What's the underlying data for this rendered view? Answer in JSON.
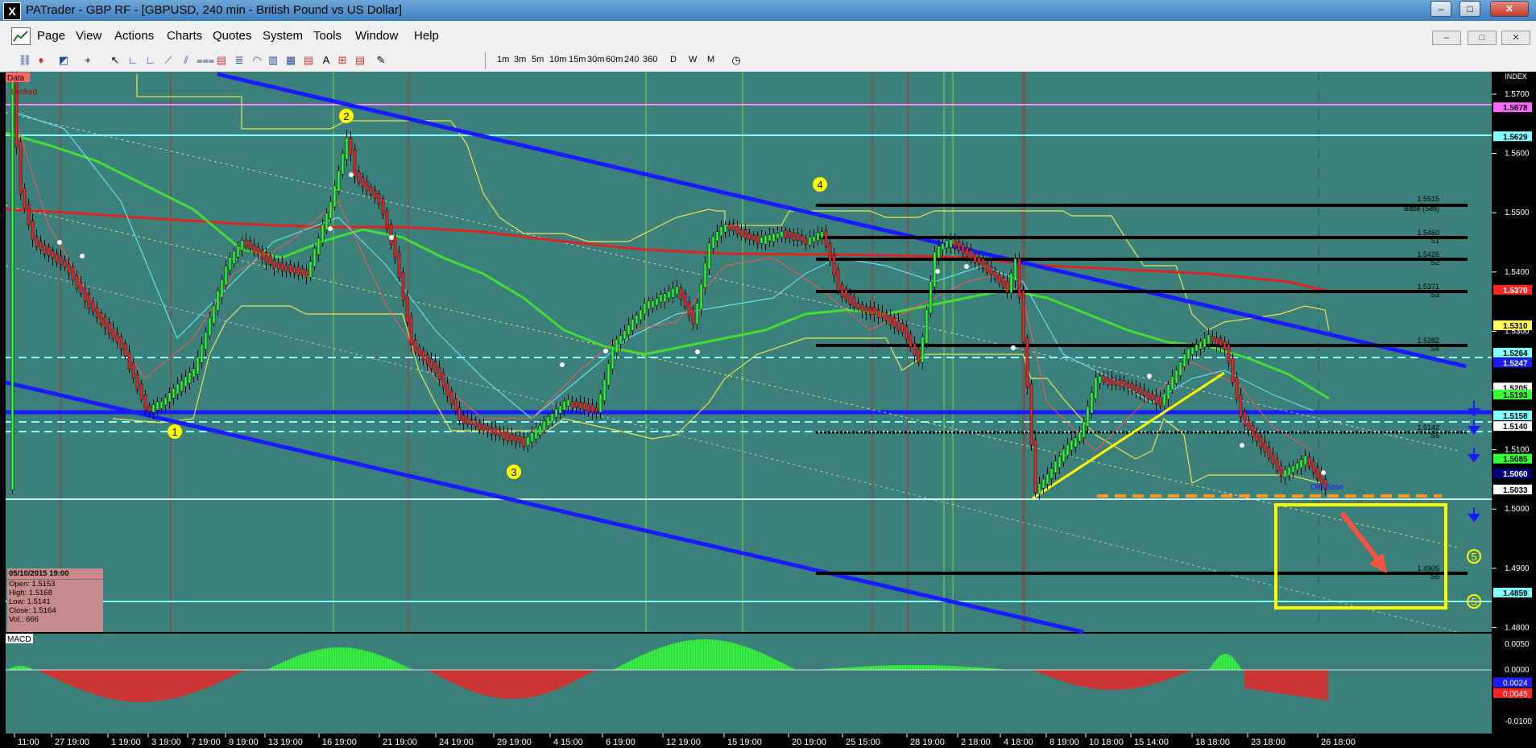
{
  "window": {
    "title": "PATrader - GBP RF - [GBPUSD, 240 min - British Pound vs US Dollar]",
    "app_icon": "X",
    "minimize": "–",
    "maximize": "□",
    "close": "✕"
  },
  "menu": [
    "Page",
    "View",
    "Actions",
    "Charts",
    "Quotes",
    "System",
    "Tools",
    "Window",
    "Help"
  ],
  "timeframes": [
    "1m",
    "3m",
    "5m",
    "10m",
    "15m",
    "30m",
    "60m",
    "240",
    "360",
    "D",
    "W",
    "M"
  ],
  "chart": {
    "top_label_data": "Data",
    "top_label_locked": "Locked",
    "index_label": "INDEX",
    "macd_label": "MACD",
    "price_ticks": [
      "1.5700",
      "1.5600",
      "1.5500",
      "1.5400",
      "1.5300",
      "1.5200",
      "1.5100",
      "1.5000",
      "1.4900",
      "1.4800"
    ],
    "price_flags": [
      {
        "text": "1.5678",
        "bg": "#ff66ff",
        "fg": "#000"
      },
      {
        "text": "1.5629",
        "bg": "#7fffff",
        "fg": "#000"
      },
      {
        "text": "1.5370",
        "bg": "#ff2222",
        "fg": "#fff"
      },
      {
        "text": "1.5310",
        "bg": "#ffff55",
        "fg": "#000"
      },
      {
        "text": "1.5264",
        "bg": "#7fffff",
        "fg": "#000"
      },
      {
        "text": "1.5247",
        "bg": "#1a1aff",
        "fg": "#fff"
      },
      {
        "text": "1.5205",
        "bg": "#ffffff",
        "fg": "#000"
      },
      {
        "text": "1.5193",
        "bg": "#33ff33",
        "fg": "#000"
      },
      {
        "text": "1.5158",
        "bg": "#7fffff",
        "fg": "#000"
      },
      {
        "text": "1.5140",
        "bg": "#ffffff",
        "fg": "#000"
      },
      {
        "text": "1.5085",
        "bg": "#33ff33",
        "fg": "#000"
      },
      {
        "text": "1.5060",
        "bg": "#000080",
        "fg": "#fff"
      },
      {
        "text": "1.5033",
        "bg": "#ffffff",
        "fg": "#000"
      },
      {
        "text": "1.4859",
        "bg": "#7fffff",
        "fg": "#000"
      }
    ],
    "pivot_labels": [
      {
        "price": "1.5515",
        "name": "Base (Sell)"
      },
      {
        "price": "1.5460",
        "name": "S1"
      },
      {
        "price": "1.5426",
        "name": "S2"
      },
      {
        "price": "1.5371",
        "name": "S3"
      },
      {
        "price": "1.5282",
        "name": "S4"
      },
      {
        "price": "1.5142",
        "name": "S5"
      },
      {
        "price": "1.4905",
        "name": "S6"
      }
    ],
    "old_base_label": "Old Base",
    "wave_labels": [
      "1",
      "2",
      "3",
      "4",
      "5",
      "5"
    ],
    "macd_ticks": [
      "0.0050",
      "0.0000",
      "-0.0050",
      "-0.0100"
    ],
    "macd_flags": [
      "0.0045",
      "0.0024"
    ],
    "date_ticks": [
      "11:00",
      "27 19:00",
      "1 19:00",
      "3 19:00",
      "7 19:00",
      "9 19:00",
      "13 19:00",
      "16 19:00",
      "21 19:00",
      "24 19:00",
      "29 19:00",
      "4 15:00",
      "6 19:00",
      "12 19:00",
      "15 19:00",
      "20 19:00",
      "25 15:00",
      "28 19:00",
      "2 18:00",
      "4 18:00",
      "8 19:00",
      "10 18:00",
      "15 14:00",
      "18 18:00",
      "23 18:00",
      "26 18:00"
    ]
  },
  "ohlc": {
    "date": "05/10/2015 19:00",
    "open": "Open: 1.5153",
    "high": "High: 1.5168",
    "low": "Low: 1.5141",
    "close": "Close: 1.5164",
    "vol": "Vol.: 666"
  },
  "colors": {
    "chart_bg": "#3b807a",
    "bull": "#33ff33",
    "bear": "#ff2222",
    "channel": "#1a1aff",
    "highlight": "#ffff00"
  }
}
